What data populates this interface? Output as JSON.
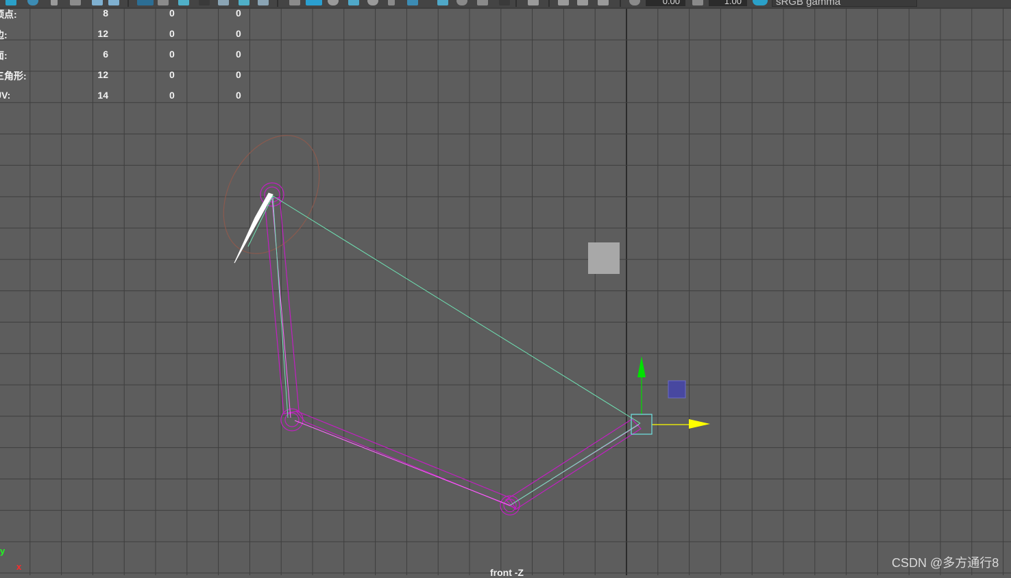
{
  "toolbar": {
    "exposure_value": "0.00",
    "gamma_value": "1.00",
    "color_space": "sRGB gamma"
  },
  "hud": {
    "rows": [
      {
        "label": "顶点:",
        "c1": "8",
        "c2": "0",
        "c3": "0"
      },
      {
        "label": "边:",
        "c1": "12",
        "c2": "0",
        "c3": "0"
      },
      {
        "label": "面:",
        "c1": "6",
        "c2": "0",
        "c3": "0"
      },
      {
        "label": "三角形:",
        "c1": "12",
        "c2": "0",
        "c3": "0"
      },
      {
        "label": "UV:",
        "c1": "14",
        "c2": "0",
        "c3": "0"
      }
    ]
  },
  "viewport": {
    "camera_label": "front -Z",
    "axis_indicator": {
      "y": "y",
      "x": "x"
    },
    "colors": {
      "background": "#5d5d5d",
      "grid": "#3e3e3e",
      "grid_axis": "#2b2b2b",
      "bone": "#c21fc2",
      "ik_handle": "#6fe3b4",
      "pole_circle": "#8a5a4e",
      "move_y_arrow": "#00e000",
      "move_x_arrow": "#ffff00",
      "cube": "#a8a8a8",
      "blue_box": "#4848a0"
    }
  },
  "watermark": "CSDN @多方通行8"
}
